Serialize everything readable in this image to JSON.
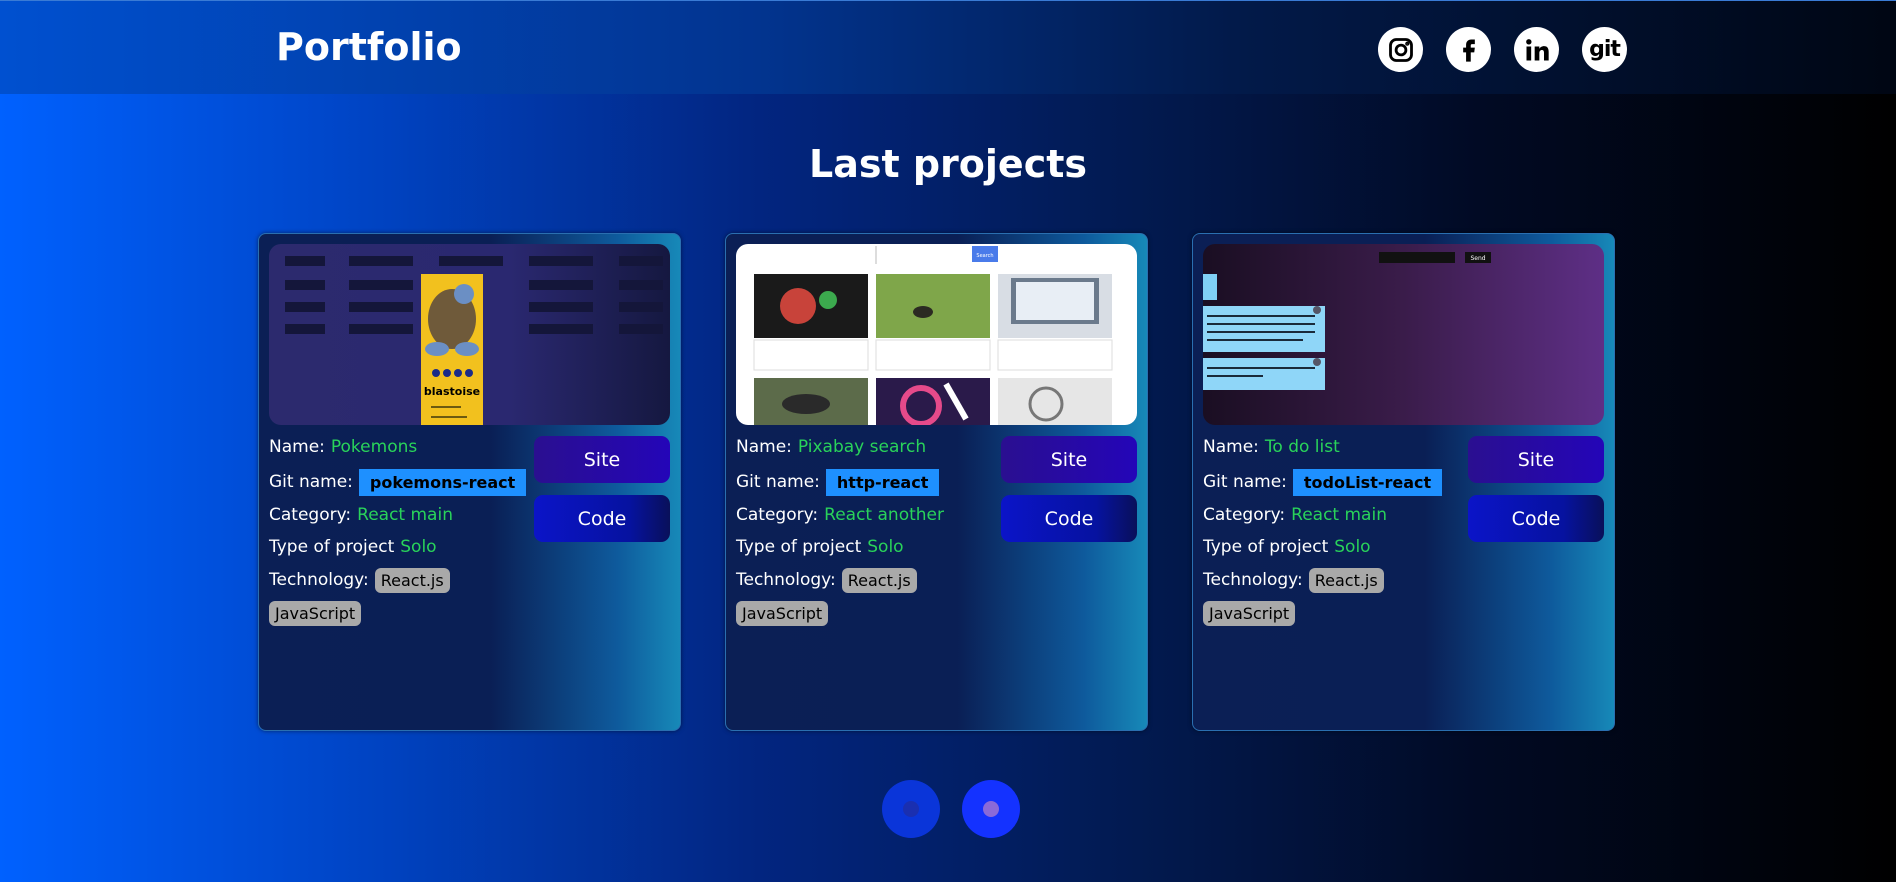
{
  "header": {
    "logo": "Portfolio"
  },
  "social": [
    {
      "icon": "instagram-icon"
    },
    {
      "icon": "facebook-icon"
    },
    {
      "icon": "linkedin-icon"
    },
    {
      "icon": "git-icon",
      "text": "git"
    }
  ],
  "section": {
    "title": "Last projects"
  },
  "labels": {
    "name": "Name:",
    "git": "Git name:",
    "category": "Category:",
    "type": "Type of project",
    "technology": "Technology:",
    "site": "Site",
    "code": "Code"
  },
  "projects": [
    {
      "name": "Pokemons",
      "git_name": "pokemons-react",
      "category": "React main",
      "type": "Solo",
      "technologies": [
        "React.js",
        "JavaScript"
      ],
      "preview_text": "blastoise"
    },
    {
      "name": "Pixabay search",
      "git_name": "http-react",
      "category": "React another",
      "type": "Solo",
      "technologies": [
        "React.js",
        "JavaScript"
      ],
      "preview_text": "Search"
    },
    {
      "name": "To do list",
      "git_name": "todoList-react",
      "category": "React main",
      "type": "Solo",
      "technologies": [
        "React.js",
        "JavaScript"
      ],
      "preview_text": "Send"
    }
  ],
  "pagination": {
    "pages": 2,
    "active": 2
  }
}
